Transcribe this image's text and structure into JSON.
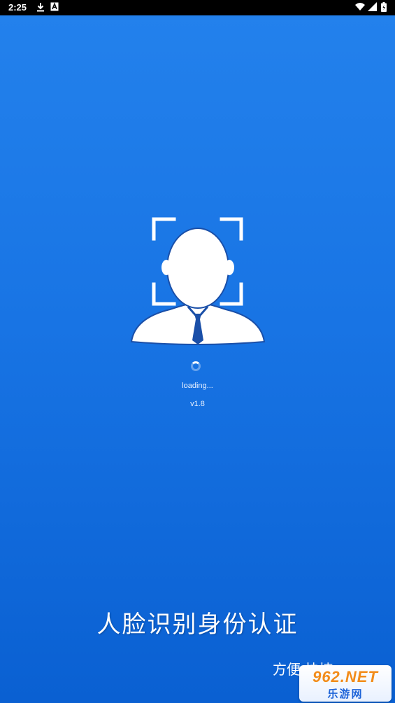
{
  "status_bar": {
    "time": "2:25",
    "left_icons": [
      "download-icon",
      "a-badge-icon"
    ],
    "right_icons": [
      "wifi-icon",
      "signal-icon",
      "battery-icon"
    ]
  },
  "splash": {
    "logo_icon": "face-recognition-icon",
    "loading_text": "loading...",
    "version": "v1.8",
    "slogan": "人脸识别身份认证",
    "tagline": "方便 快捷"
  },
  "watermark": {
    "top": "962.NET",
    "bottom": "乐游网"
  },
  "colors": {
    "background_top": "#2381ec",
    "background_bottom": "#0a60d2",
    "foreground": "#ffffff",
    "watermark_accent": "#f28c1a"
  }
}
